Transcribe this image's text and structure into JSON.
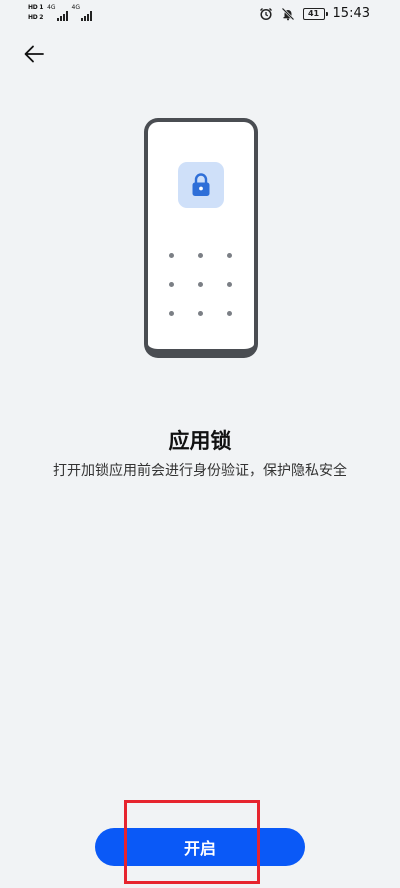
{
  "status_bar": {
    "sim1": "HD 1",
    "sim2": "HD 2",
    "net1": "4G",
    "net2": "4G",
    "battery": "41",
    "time": "15:43",
    "icons": [
      "alarm-icon",
      "mute-bell-icon",
      "battery-icon"
    ]
  },
  "nav": {
    "back_icon": "arrow-left-icon"
  },
  "illustration": {
    "lock_icon": "padlock-icon",
    "accent": "#2f6fd8",
    "tile_color": "#cfe0f9"
  },
  "feature": {
    "title": "应用锁",
    "description": "打开加锁应用前会进行身份验证，保护隐私安全"
  },
  "actions": {
    "enable_label": "开启",
    "enable_color": "#0a59f7"
  },
  "annotation": {
    "highlight_color": "#e6242e"
  }
}
